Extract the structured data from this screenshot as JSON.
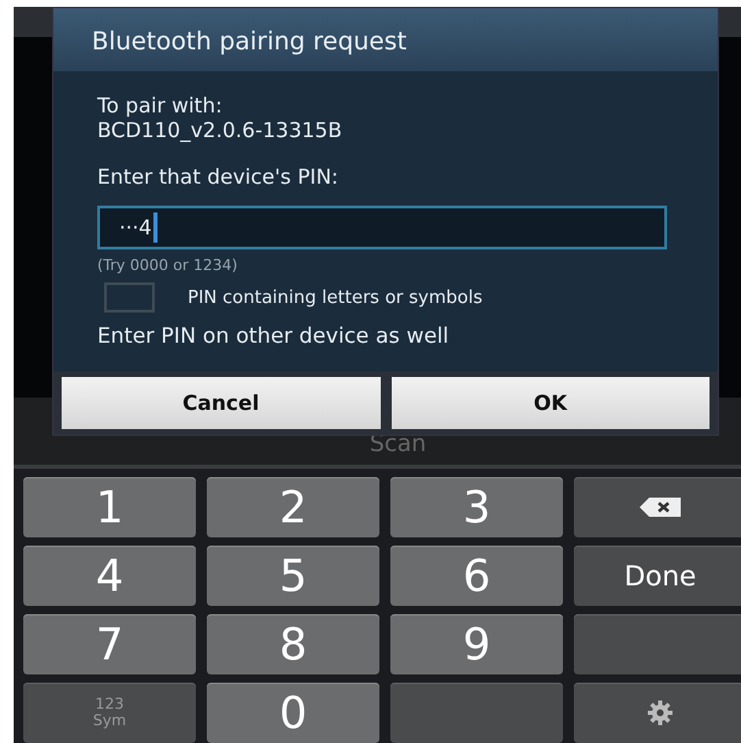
{
  "background": {
    "scan_label": "Scan"
  },
  "dialog": {
    "title": "Bluetooth pairing request",
    "pair_with_label": "To pair with:",
    "device_name": "BCD110_v2.0.6-13315B",
    "pin_prompt": "Enter that device's PIN:",
    "pin_field": {
      "value": "···4"
    },
    "hint": "(Try 0000 or 1234)",
    "letters_option": {
      "label": "PIN containing letters or symbols",
      "checked": false
    },
    "note": "Enter PIN on other device as well",
    "buttons": [
      "Cancel",
      "OK"
    ]
  },
  "keyboard": {
    "keys": [
      {
        "kind": "digit",
        "label": "1"
      },
      {
        "kind": "digit",
        "label": "2"
      },
      {
        "kind": "digit",
        "label": "3"
      },
      {
        "kind": "backspace"
      },
      {
        "kind": "digit",
        "label": "4"
      },
      {
        "kind": "digit",
        "label": "5"
      },
      {
        "kind": "digit",
        "label": "6"
      },
      {
        "kind": "done",
        "label": "Done"
      },
      {
        "kind": "digit",
        "label": "7"
      },
      {
        "kind": "digit",
        "label": "8"
      },
      {
        "kind": "digit",
        "label": "9"
      },
      {
        "kind": "blank"
      },
      {
        "kind": "sym",
        "label": "123",
        "sublabel": "Sym"
      },
      {
        "kind": "digit",
        "label": "0"
      },
      {
        "kind": "blank"
      },
      {
        "kind": "settings"
      }
    ]
  }
}
